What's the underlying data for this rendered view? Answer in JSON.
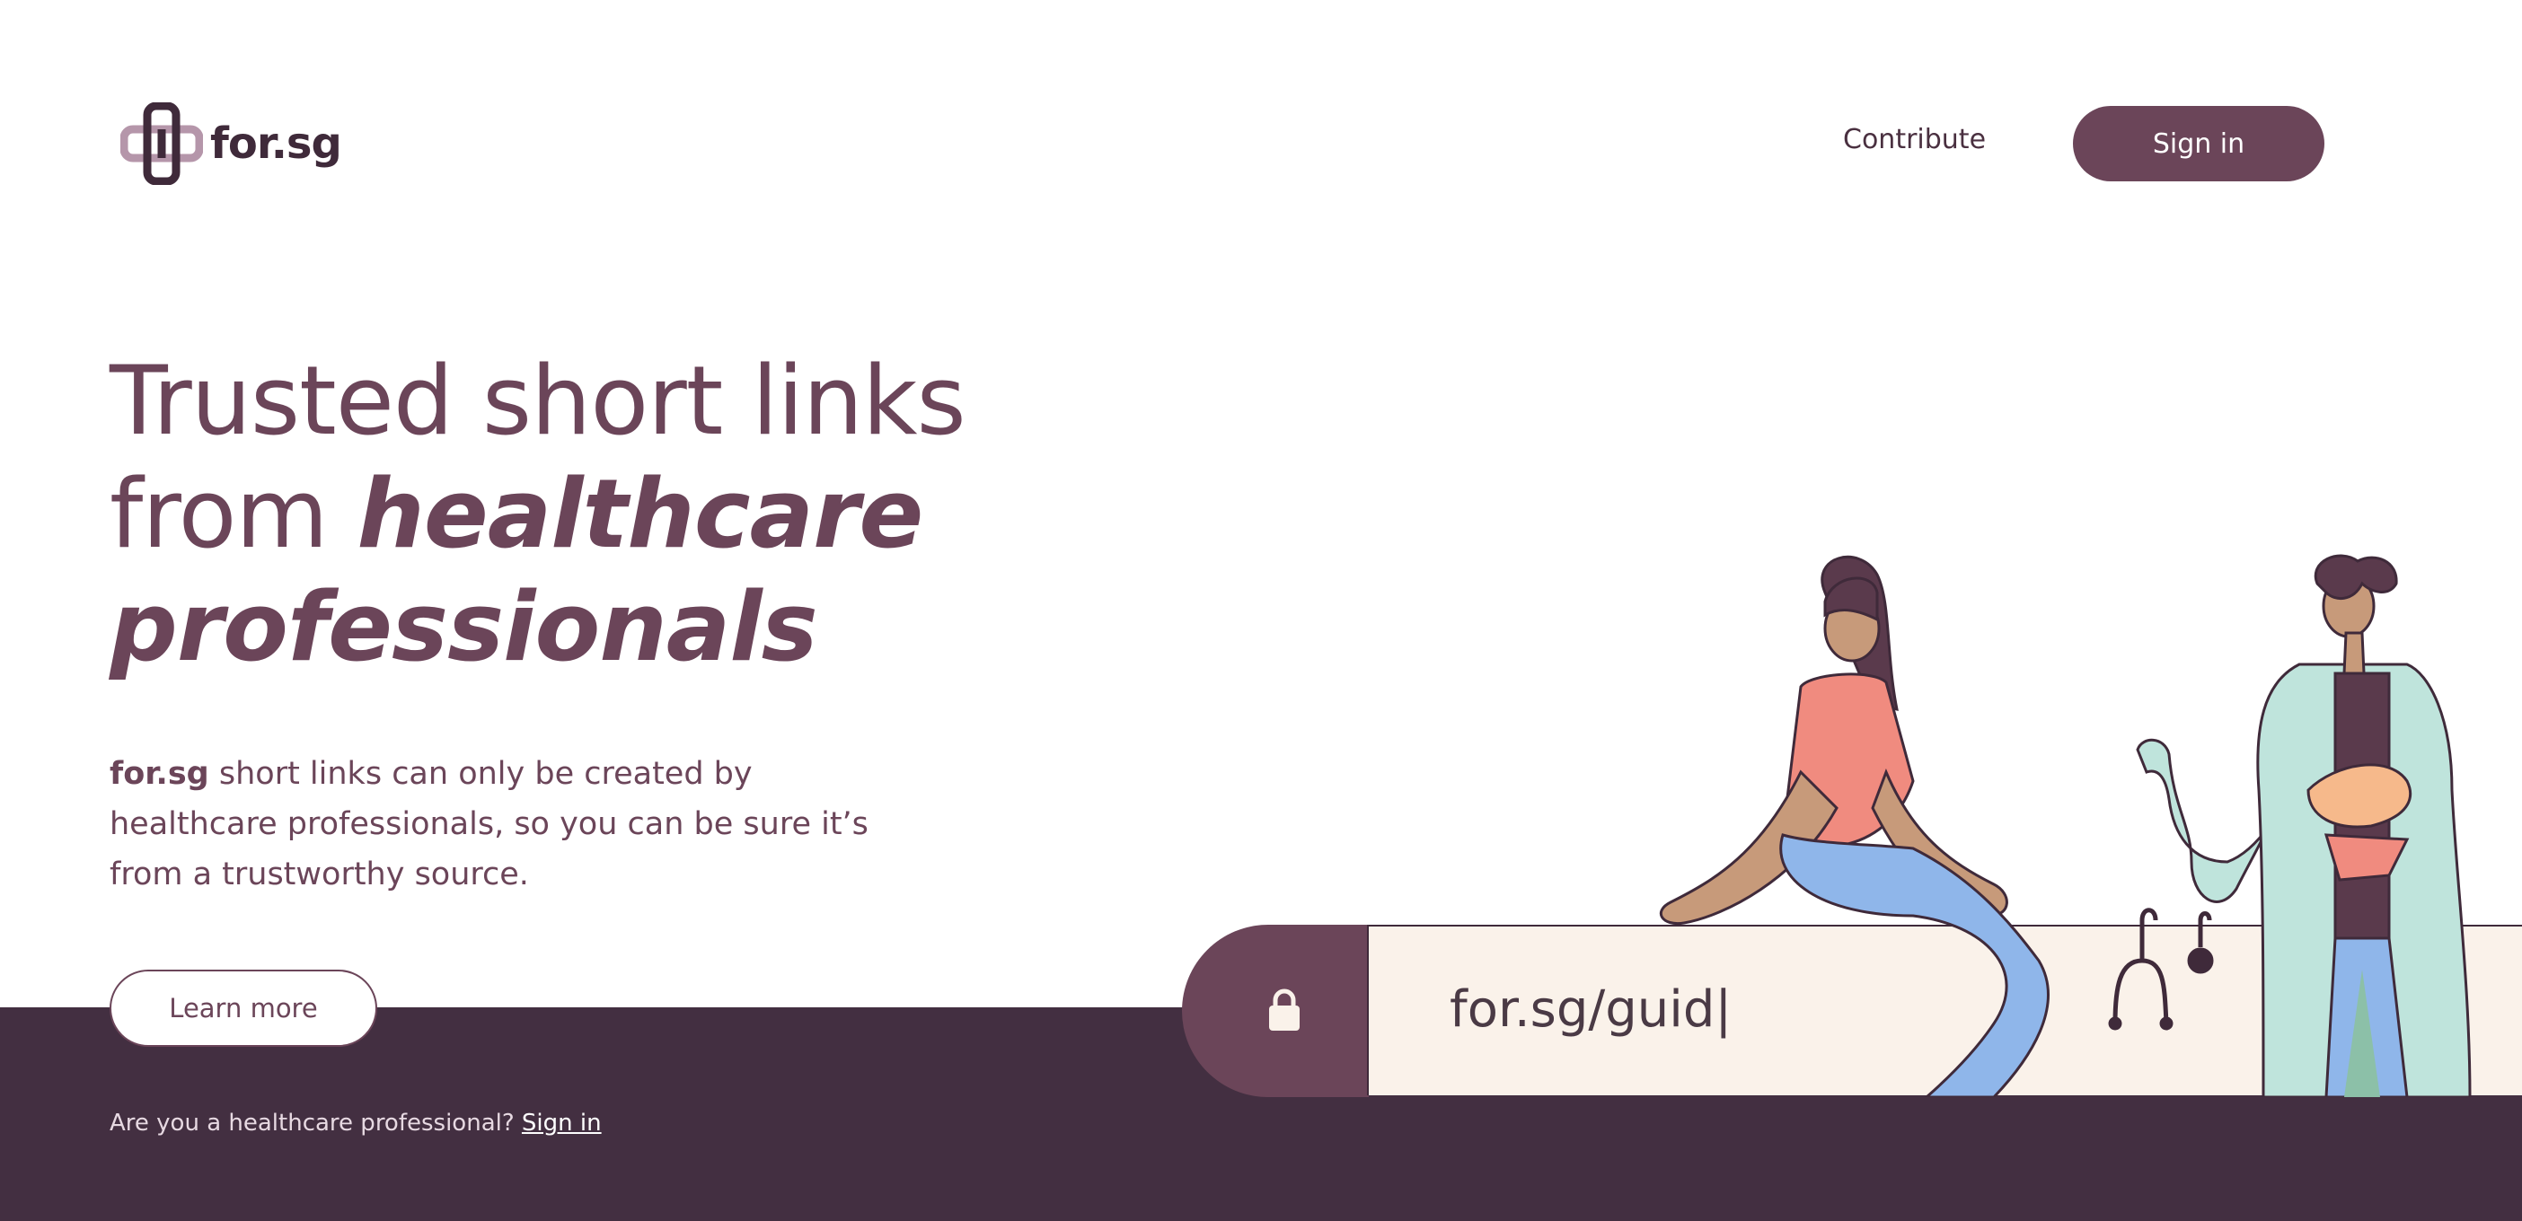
{
  "brand": {
    "name": "for.sg"
  },
  "nav": {
    "contribute": "Contribute",
    "signin": "Sign in"
  },
  "hero": {
    "title_line1": "Trusted short links",
    "title_from": "from ",
    "title_em1": "healthcare",
    "title_em2": "professionals",
    "desc_bold": "for.sg",
    "desc_rest": " short links can only be created by healthcare professionals, so you can be sure it’s from a trustworthy source.",
    "learn_more": "Learn more"
  },
  "url_bar": {
    "value": "for.sg/guid|",
    "icon": "lock-icon"
  },
  "footer": {
    "question": "Are you a healthcare professional? ",
    "signin_link": "Sign in"
  },
  "colors": {
    "primary": "#6b4559",
    "dark": "#432f41",
    "cream": "#faf2ea"
  }
}
